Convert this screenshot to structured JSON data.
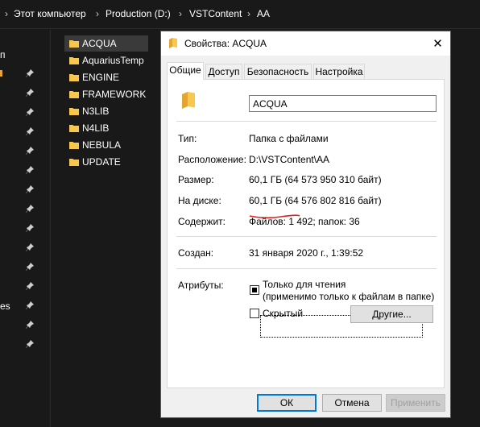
{
  "breadcrumb": {
    "items": [
      "Этот компьютер",
      "Production (D:)",
      "VSTContent",
      "AA"
    ]
  },
  "nav": {
    "fragments": [
      "п",
      "es"
    ]
  },
  "files": [
    "ACQUA",
    "AquariusTemp",
    "ENGINE",
    "FRAMEWORK",
    "N3LIB",
    "N4LIB",
    "NEBULA",
    "UPDATE"
  ],
  "selected_file": "ACQUA",
  "dialog": {
    "title": "Свойства: ACQUA",
    "close": "✕",
    "tabs": [
      "Общие",
      "Доступ",
      "Безопасность",
      "Настройка"
    ],
    "active_tab": "Общие",
    "name": "ACQUA",
    "props": {
      "type_label": "Тип:",
      "type_value": "Папка с файлами",
      "location_label": "Расположение:",
      "location_value": "D:\\VSTContent\\AA",
      "size_label": "Размер:",
      "size_value": "60,1 ГБ (64 573 950 310 байт)",
      "ondisk_label": "На диске:",
      "ondisk_value": "60,1 ГБ (64 576 802 816 байт)",
      "contains_label": "Содержит:",
      "contains_value": "Файлов: 1 492; папок: 36",
      "created_label": "Создан:",
      "created_value": "31 января 2020 г., 1:39:52",
      "attributes_label": "Атрибуты:",
      "readonly_label_1": "Только для чтения",
      "readonly_label_2": "(применимо только к файлам в папке)",
      "hidden_label": "Скрытый",
      "other_button": "Другие..."
    },
    "buttons": {
      "ok": "ОК",
      "cancel": "Отмена",
      "apply": "Применить"
    }
  },
  "colors": {
    "folder": "#f8c74e",
    "annotation": "#e0201b",
    "accent": "#0078d7"
  }
}
